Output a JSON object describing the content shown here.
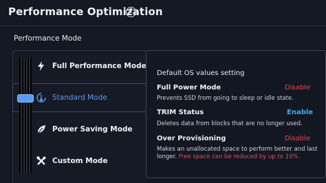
{
  "header": {
    "title": "Performance Optimization",
    "help_icon": "question-circle-icon"
  },
  "section": {
    "title": "Performance Mode"
  },
  "modes": [
    {
      "label": "Full Performance Mode",
      "icon": "lightning-icon",
      "selected": false
    },
    {
      "label": "Standard Mode",
      "icon": "thermometer-icon",
      "selected": true
    },
    {
      "label": "Power Saving Mode",
      "icon": "leaf-icon",
      "selected": false
    },
    {
      "label": "Custom Mode",
      "icon": "tools-icon",
      "selected": false
    }
  ],
  "details": {
    "heading": "Default OS values setting",
    "rows": [
      {
        "title": "Full Power Mode",
        "status": "Disable",
        "desc": "Prevents SSD from going to sleep or idle state."
      },
      {
        "title": "TRIM Status",
        "status": "Enable",
        "desc": "Deletes data from blocks that are no longer used."
      },
      {
        "title": "Over Provisioning",
        "status": "Disable",
        "desc_line1": "Makes an unallocated space to perform better and last",
        "desc_line2_a": "longer.",
        "desc_line2_b": "Free space can be reduced by up to 10%."
      }
    ]
  },
  "colors": {
    "accent": "#5a9bf0",
    "disable": "#e64a55",
    "enable": "#4aa8e8",
    "background": "#131823"
  }
}
